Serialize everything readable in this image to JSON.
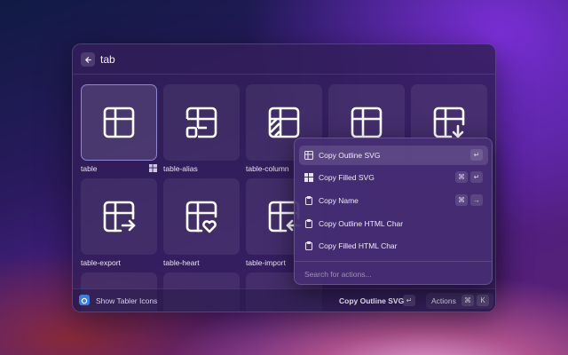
{
  "search": {
    "query": "tab"
  },
  "grid": {
    "items": [
      {
        "label": "table",
        "icon": "table-icon"
      },
      {
        "label": "table-alias",
        "icon": "table-alias-icon"
      },
      {
        "label": "table-column",
        "icon": "table-column-icon"
      },
      {
        "label": "",
        "icon": "table-icon"
      },
      {
        "label": "",
        "icon": "table-down-icon"
      },
      {
        "label": "table-export",
        "icon": "table-export-icon"
      },
      {
        "label": "table-heart",
        "icon": "table-heart-icon"
      },
      {
        "label": "table-import",
        "icon": "table-import-icon"
      }
    ]
  },
  "footer": {
    "app_name": "Show Tabler Icons",
    "primary_action": "Copy Outline SVG",
    "primary_key": "↵",
    "actions_label": "Actions",
    "actions_keys": [
      "⌘",
      "K"
    ]
  },
  "menu": {
    "items": [
      {
        "label": "Copy Outline SVG",
        "keys": [
          "↵"
        ]
      },
      {
        "label": "Copy Filled SVG",
        "keys": [
          "⌘",
          "↵"
        ]
      },
      {
        "label": "Copy Name",
        "keys": [
          "⌘",
          "→"
        ]
      },
      {
        "label": "Copy Outline HTML Char",
        "keys": []
      },
      {
        "label": "Copy Filled HTML Char",
        "keys": []
      }
    ],
    "search_placeholder": "Search for actions..."
  },
  "colors": {
    "accent": "#8f86d6",
    "app_logo": "#3d7fe0"
  }
}
